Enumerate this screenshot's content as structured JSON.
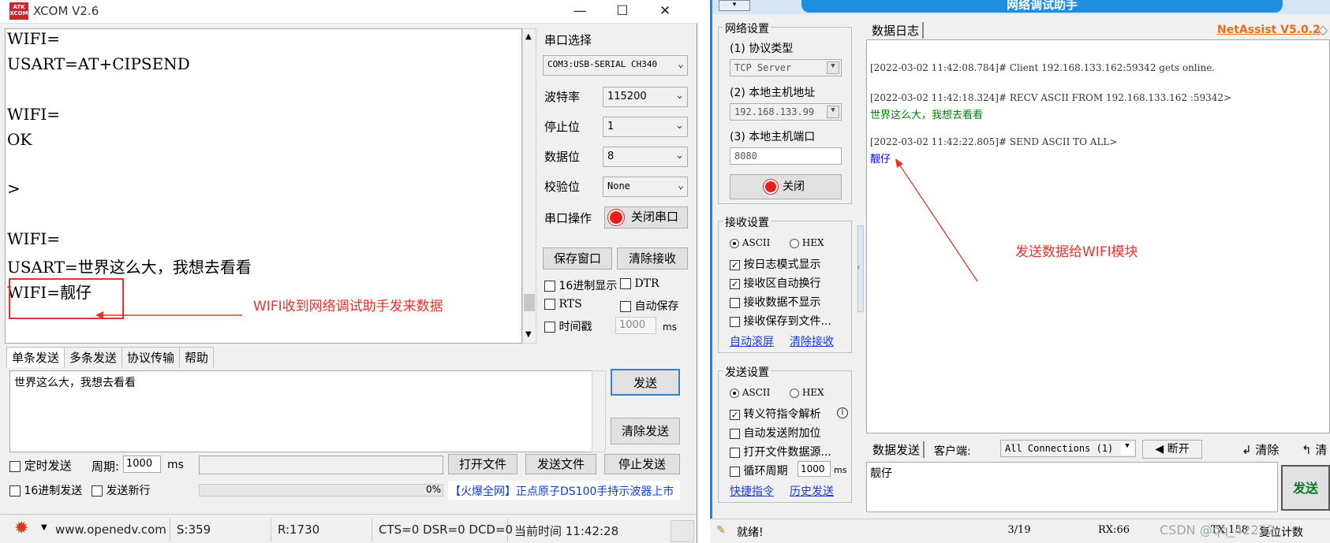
{
  "xcom": {
    "title": "XCOM V2.6",
    "logo_text": "ATK XCOM",
    "window_buttons": {
      "minimize": "—",
      "maximize": "☐",
      "close": "✕"
    },
    "receive_lines": [
      "WIFI=",
      "USART=AT+CIPSEND",
      "",
      "WIFI=",
      "OK",
      "",
      ">",
      "",
      "WIFI=",
      "USART=世界这么大，我想去看看",
      "WIFI=靓仔"
    ],
    "annotation": "WIFI收到网络调试助手发来数据",
    "port_label": "串口选择",
    "port_value": "COM3:USB-SERIAL CH340",
    "baud_label": "波特率",
    "baud_value": "115200",
    "stop_label": "停止位",
    "stop_value": "1",
    "data_label": "数据位",
    "data_value": "8",
    "parity_label": "校验位",
    "parity_value": "None",
    "op_label": "串口操作",
    "close_port_btn": "关闭串口",
    "save_window_btn": "保存窗口",
    "clear_recv_btn": "清除接收",
    "hex_display": "16进制显示",
    "dtr": "DTR",
    "rts": "RTS",
    "auto_save": "自动保存",
    "timestamp": "时间戳",
    "timestamp_value": "1000",
    "ms": "ms",
    "tabs": [
      "单条发送",
      "多条发送",
      "协议传输",
      "帮助"
    ],
    "send_text": "世界这么大，我想去看看",
    "send_btn": "发送",
    "clear_send_btn": "清除发送",
    "timed_send": "定时发送",
    "period_label": "周期:",
    "period_value": "1000",
    "period_unit": "ms",
    "open_file_btn": "打开文件",
    "send_file_btn": "发送文件",
    "stop_send_btn": "停止发送",
    "hex_send": "16进制发送",
    "send_newline": "发送新行",
    "progress_text": "0%",
    "progress": 0,
    "ad_text": "【火爆全网】正点原子DS100手持示波器上市",
    "status": {
      "url": "www.openedv.com",
      "s": "S:359",
      "r": "R:1730",
      "lines": "CTS=0 DSR=0 DCD=0",
      "time": "当前时间 11:42:28"
    }
  },
  "net": {
    "title": "网络调试助手",
    "net_settings": "网络设置",
    "protocol_label": "(1) 协议类型",
    "protocol_value": "TCP Server",
    "host_label": "(2) 本地主机地址",
    "host_value": "192.168.133.99",
    "port_label": "(3) 本地主机端口",
    "port_value": "8080",
    "close_btn": "关闭",
    "recv_settings": "接收设置",
    "ascii": "ASCII",
    "hex": "HEX",
    "log_mode": "按日志模式显示",
    "auto_wrap": "接收区自动换行",
    "hide_recv": "接收数据不显示",
    "save_to_file": "接收保存到文件...",
    "auto_scroll": "自动滚屏",
    "clear_recv": "清除接收",
    "send_settings": "发送设置",
    "escape_parse": "转义符指令解析",
    "auto_append": "自动发送附加位",
    "open_file_src": "打开文件数据源...",
    "loop_period": "循环周期",
    "loop_value": "1000",
    "loop_unit": "ms",
    "quick_cmd": "快捷指令",
    "history_send": "历史发送",
    "log_tab": "数据日志",
    "brand": "NetAssist V5.0.2",
    "log_lines": [
      {
        "text": "[2022-03-02 11:42:08.784]# Client 192.168.133.162:59342 gets online.",
        "color": "#333333"
      },
      {
        "text": "[2022-03-02 11:42:18.324]# RECV ASCII FROM 192.168.133.162 :59342>",
        "color": "#333333"
      },
      {
        "text": "世界这么大，我想去看看",
        "color": "#008000"
      },
      {
        "text": "[2022-03-02 11:42:22.805]# SEND ASCII TO ALL>",
        "color": "#333333"
      },
      {
        "text": "靓仔",
        "color": "#0000ff"
      }
    ],
    "annotation": "发送数据给WIFI模块",
    "send_tab": "数据发送",
    "client_label": "客户端:",
    "client_value": "All Connections (1)",
    "disconnect_btn": "断开",
    "clear_btn": "清除",
    "clear_btn2": "清",
    "send_text": "靓仔",
    "send_btn": "发送",
    "status_ready": "就绪!",
    "count": "3/19",
    "rx": "RX:66",
    "tx": "TX:158",
    "reset": "复位计数",
    "watermark": "CSDN @qq_42222"
  }
}
